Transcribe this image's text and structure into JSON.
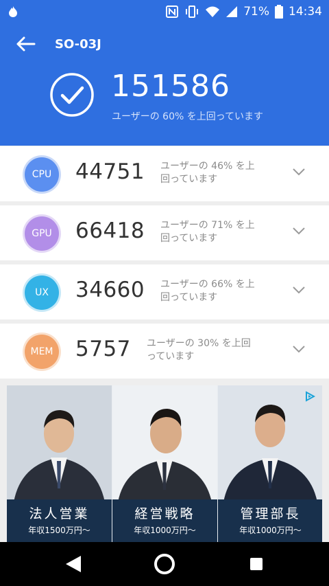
{
  "status_bar": {
    "battery_text": "71%",
    "time": "14:34",
    "icons": [
      "flame-icon",
      "nfc-icon",
      "vibrate-icon",
      "wifi-icon",
      "signal-icon",
      "battery-icon"
    ]
  },
  "header": {
    "model": "SO-03J",
    "total_score": "151586",
    "total_subtitle": "ユーザーの 60% を上回っています",
    "accent_color": "#2f6fe0"
  },
  "scores": [
    {
      "badge": "CPU",
      "score": "44751",
      "desc_line1": "ユーザーの 46% を上",
      "desc_line2": "回っています",
      "badge_color": "#5b8ff0"
    },
    {
      "badge": "GPU",
      "score": "66418",
      "desc_line1": "ユーザーの 71% を上",
      "desc_line2": "回っています",
      "badge_color": "#b28ee8"
    },
    {
      "badge": "UX",
      "score": "34660",
      "desc_line1": "ユーザーの 66% を上",
      "desc_line2": "回っています",
      "badge_color": "#33b2e6"
    },
    {
      "badge": "MEM",
      "score": "5757",
      "desc_line1": "ユーザーの 30% を上回",
      "desc_line2": "っています",
      "badge_color": "#f2a36a"
    }
  ],
  "ad": {
    "panels": [
      {
        "title": "法人営業",
        "subtitle": "年収1500万円〜"
      },
      {
        "title": "経営戦略",
        "subtitle": "年収1000万円〜"
      },
      {
        "title": "管理部長",
        "subtitle": "年収1000万円〜"
      }
    ]
  }
}
